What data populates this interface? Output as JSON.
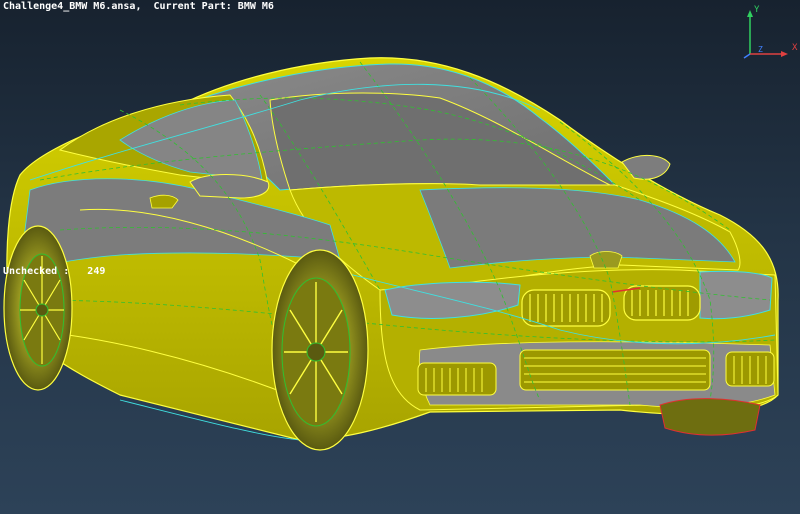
{
  "viewport": {
    "title": "Challenge4_BMW M6.ansa,  Current Part: BMW M6",
    "unchecked_label": "Unchecked :",
    "unchecked_count": "249",
    "background_top": "#17222f",
    "background_bottom": "#2d4258"
  },
  "triad": {
    "x_label": "X",
    "y_label": "Y",
    "z_label": "Z",
    "x_color": "#e04040",
    "y_color": "#30d060",
    "z_color": "#4080ff"
  },
  "model": {
    "name": "BMW M6",
    "surface_color": "#c8c400",
    "shade_color": "#7d7d7d",
    "edge_color_yellow": "#ffff40",
    "edge_color_cyan": "#40e0e0",
    "edge_color_green": "#30c030",
    "edge_color_red": "#e03030"
  }
}
